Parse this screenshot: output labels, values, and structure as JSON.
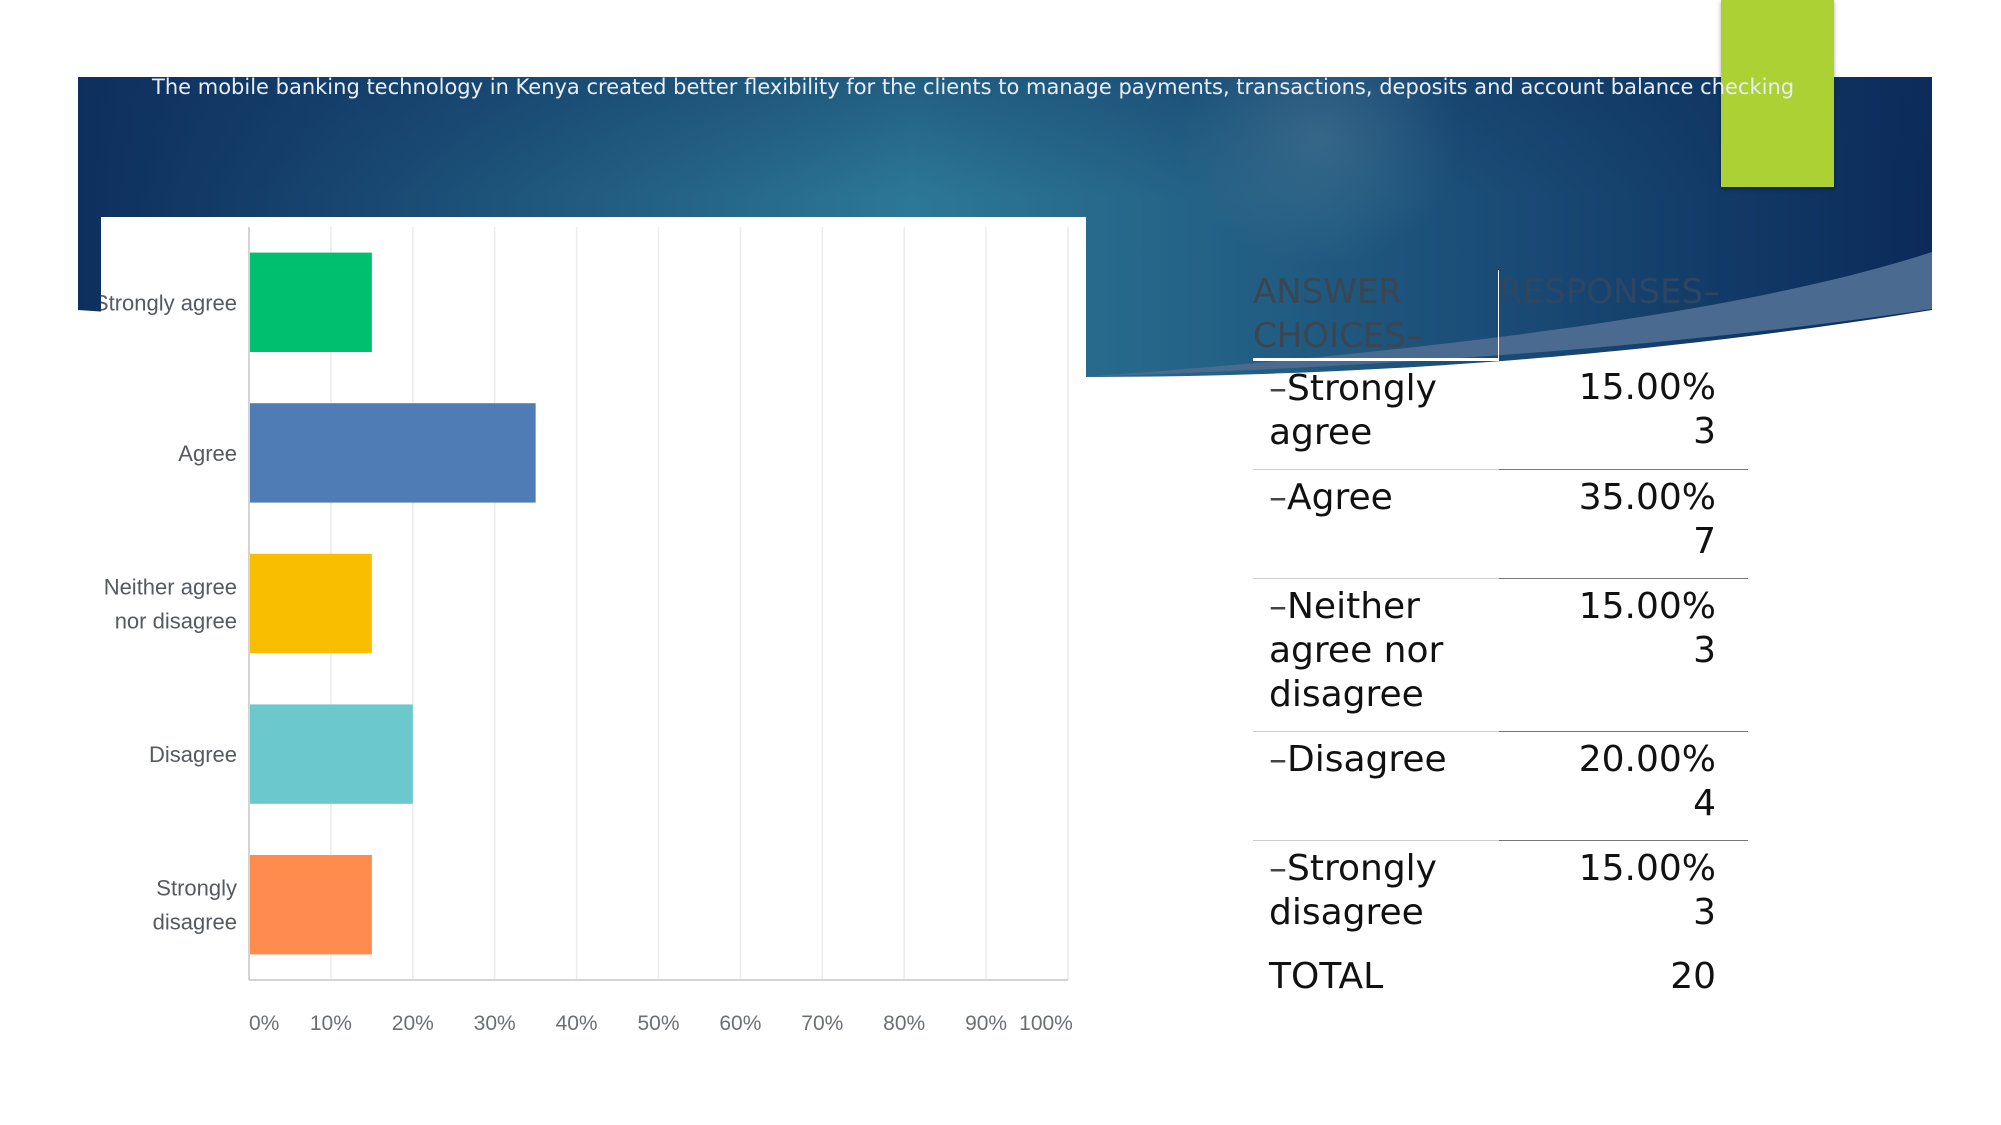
{
  "slide": {
    "title": "The mobile banking technology in Kenya created better flexibility for the clients to manage payments, transactions, deposits and account balance checking",
    "colors": {
      "banner_dark": "#0e2f5e",
      "banner_mid": "#2e7a96",
      "accent_lime": "#abd134",
      "swoosh": "#4a6a90"
    }
  },
  "chart_data": {
    "type": "bar",
    "orientation": "horizontal",
    "title": "",
    "xlabel": "",
    "ylabel": "",
    "categories": [
      "Strongly agree",
      "Agree",
      "Neither agree nor disagree",
      "Disagree",
      "Strongly disagree"
    ],
    "category_lines": [
      [
        "Strongly agree"
      ],
      [
        "Agree"
      ],
      [
        "Neither agree",
        "nor disagree"
      ],
      [
        "Disagree"
      ],
      [
        "Strongly",
        "disagree"
      ]
    ],
    "values": [
      15,
      35,
      15,
      20,
      15
    ],
    "colors": [
      "#00bf6f",
      "#507cb6",
      "#f9be00",
      "#6bc8cd",
      "#ff8b4f"
    ],
    "xlim": [
      0,
      100
    ],
    "xticks": [
      "0%",
      "10%",
      "20%",
      "30%",
      "40%",
      "50%",
      "60%",
      "70%",
      "80%",
      "90%",
      "100%"
    ],
    "grid": true,
    "legend": "none"
  },
  "table": {
    "headers": [
      "ANSWER CHOICES–",
      "RESPONSES–"
    ],
    "rows": [
      {
        "choice": "Strongly agree",
        "percent": "15.00%",
        "count": "3"
      },
      {
        "choice": "Agree",
        "percent": "35.00%",
        "count": "7"
      },
      {
        "choice": "Neither agree nor disagree",
        "percent": "15.00%",
        "count": "3"
      },
      {
        "choice": "Disagree",
        "percent": "20.00%",
        "count": "4"
      },
      {
        "choice": "Strongly disagree",
        "percent": "15.00%",
        "count": "3"
      }
    ],
    "total_label": "TOTAL",
    "total_value": "20",
    "dash": "–"
  }
}
